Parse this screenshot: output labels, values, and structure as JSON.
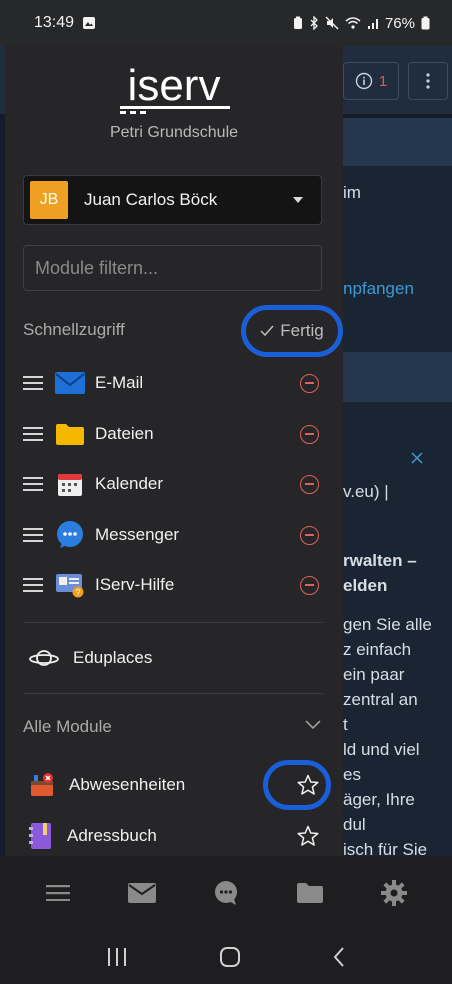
{
  "status_bar": {
    "time": "13:49",
    "battery": "76%"
  },
  "background": {
    "info_count": "1",
    "snippets": [
      "im",
      "npfangen",
      "v.eu) |",
      "rwalten –",
      "elden",
      "gen Sie alle",
      "z einfach",
      "ein paar",
      "zentral an",
      "t",
      "ld und viel",
      "es",
      "äger, Ihre",
      "dul",
      "isch für Sie"
    ]
  },
  "drawer": {
    "logo_text": "iserv",
    "school_name": "Petri Grundschule",
    "user": {
      "initials": "JB",
      "name": "Juan Carlos Böck"
    },
    "filter_placeholder": "Module filtern...",
    "quick_access": {
      "label": "Schnellzugriff",
      "done_label": "Fertig",
      "items": [
        {
          "label": "E-Mail",
          "icon": "mail-icon"
        },
        {
          "label": "Dateien",
          "icon": "folder-icon"
        },
        {
          "label": "Kalender",
          "icon": "calendar-icon"
        },
        {
          "label": "Messenger",
          "icon": "messenger-icon"
        },
        {
          "label": "IServ-Hilfe",
          "icon": "help-icon"
        }
      ]
    },
    "eduplaces": {
      "label": "Eduplaces",
      "icon": "planet-icon"
    },
    "all_modules": {
      "label": "Alle Module",
      "items": [
        {
          "label": "Abwesenheiten",
          "icon": "absence-icon"
        },
        {
          "label": "Adressbuch",
          "icon": "address-book-icon"
        }
      ]
    }
  },
  "bottom_nav": [
    "menu-icon",
    "mail-icon",
    "messenger-icon",
    "folder-icon",
    "gear-icon"
  ],
  "colors": {
    "accent": "#1a5fd8",
    "avatar": "#f0a020",
    "remove": "#e0605a",
    "link": "#3d9ad6"
  }
}
